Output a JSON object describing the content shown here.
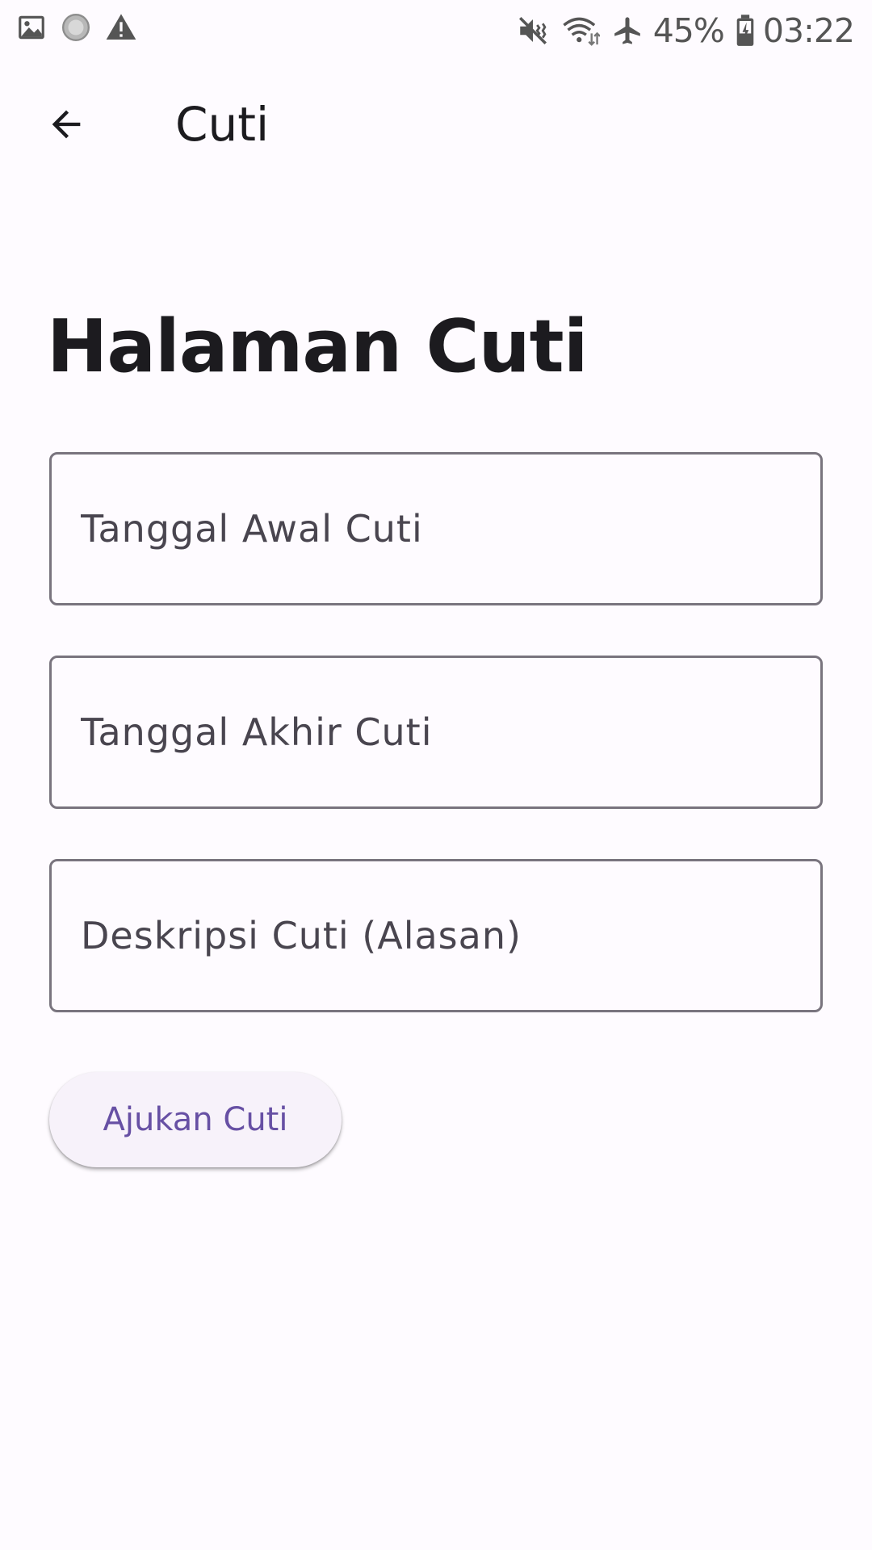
{
  "status_bar": {
    "left_icons": [
      "image-icon",
      "loading-icon",
      "warning-icon"
    ],
    "right_icons": [
      "vibrate-mute-icon",
      "wifi-icon",
      "airplane-icon"
    ],
    "battery_percent": "45%",
    "battery_icon": "battery-charging-icon",
    "time": "03:22"
  },
  "app_bar": {
    "back_icon": "arrow-back-icon",
    "title": "Cuti"
  },
  "main": {
    "heading": "Halaman Cuti",
    "fields": [
      {
        "placeholder": "Tanggal Awal Cuti",
        "value": ""
      },
      {
        "placeholder": "Tanggal Akhir Cuti",
        "value": ""
      },
      {
        "placeholder": "Deskripsi Cuti (Alasan)",
        "value": ""
      }
    ],
    "submit_label": "Ajukan Cuti"
  },
  "colors": {
    "background": "#fefbff",
    "primary": "#6750a4",
    "outline": "#79747e",
    "button_surface": "#f7f2fa",
    "text": "#1c1b1f"
  }
}
